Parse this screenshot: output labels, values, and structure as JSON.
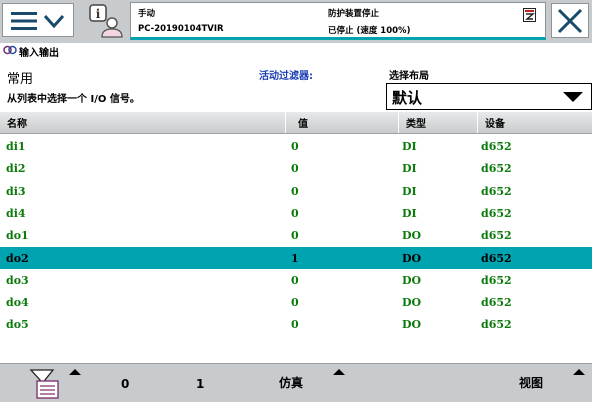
{
  "header": {
    "mode": "手动",
    "controller": "PC-20190104TVIR",
    "safety_status": "防护装置停止",
    "run_status": "已停止 (速度 100%)"
  },
  "app": {
    "title": "输入输出"
  },
  "filter": {
    "name": "常用",
    "hint": "从列表中选择一个 I/O 信号。",
    "active_filter_label": "活动过滤器:",
    "layout_label": "选择布局",
    "layout_value": "默认"
  },
  "table": {
    "columns": [
      "名称",
      "值",
      "类型",
      "设备"
    ],
    "rows": [
      {
        "name": "di1",
        "value": "0",
        "type": "DI",
        "device": "d652",
        "selected": false
      },
      {
        "name": "di2",
        "value": "0",
        "type": "DI",
        "device": "d652",
        "selected": false
      },
      {
        "name": "di3",
        "value": "0",
        "type": "DI",
        "device": "d652",
        "selected": false
      },
      {
        "name": "di4",
        "value": "0",
        "type": "DI",
        "device": "d652",
        "selected": false
      },
      {
        "name": "do1",
        "value": "0",
        "type": "DO",
        "device": "d652",
        "selected": false
      },
      {
        "name": "do2",
        "value": "1",
        "type": "DO",
        "device": "d652",
        "selected": true
      },
      {
        "name": "do3",
        "value": "0",
        "type": "DO",
        "device": "d652",
        "selected": false
      },
      {
        "name": "do4",
        "value": "0",
        "type": "DO",
        "device": "d652",
        "selected": false
      },
      {
        "name": "do5",
        "value": "0",
        "type": "DO",
        "device": "d652",
        "selected": false
      }
    ]
  },
  "toolbar": {
    "value_zero": "0",
    "value_one": "1",
    "simulate": "仿真",
    "view": "视图"
  },
  "colors": {
    "accent": "#00a3b0",
    "value_text": "#0a7a0a",
    "filter_label": "#1a3fb4"
  }
}
